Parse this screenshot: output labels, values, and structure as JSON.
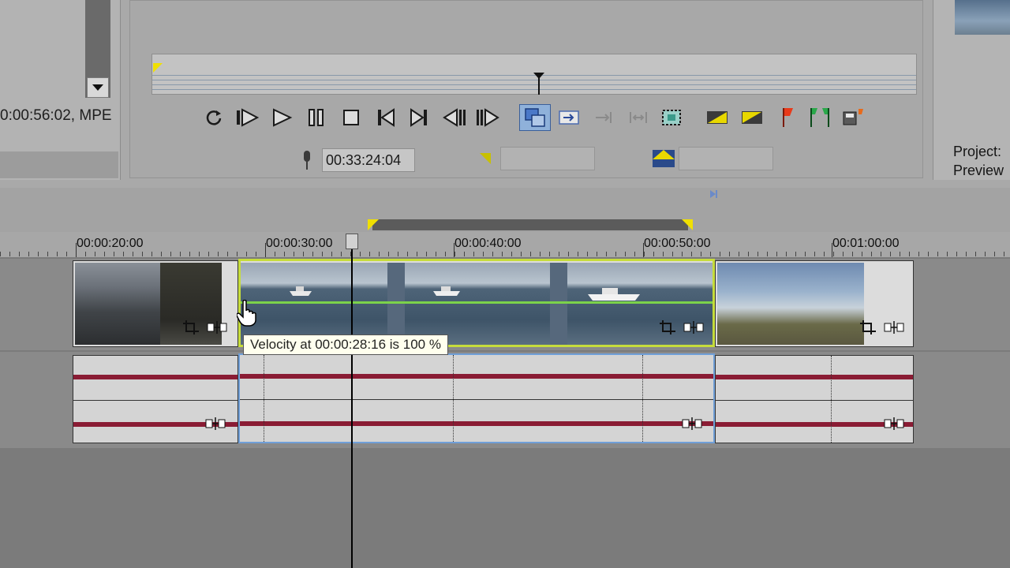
{
  "media_info": "0:00:56:02, MPE",
  "transport": {
    "buttons": [
      {
        "name": "loop-playback-button",
        "icon": "loop-icon"
      },
      {
        "name": "play-from-start-button",
        "icon": "play-from-start-icon"
      },
      {
        "name": "play-button",
        "icon": "play-icon"
      },
      {
        "name": "pause-button",
        "icon": "pause-icon"
      },
      {
        "name": "stop-button",
        "icon": "stop-icon"
      },
      {
        "name": "go-to-start-button",
        "icon": "go-to-start-icon"
      },
      {
        "name": "go-to-end-button",
        "icon": "go-to-end-icon"
      },
      {
        "name": "previous-frame-button",
        "icon": "previous-frame-icon"
      },
      {
        "name": "next-frame-button",
        "icon": "next-frame-icon"
      },
      {
        "name": "select-button",
        "icon": "select-icon",
        "active": true
      },
      {
        "name": "add-to-timeline-button",
        "icon": "add-to-timeline-icon"
      },
      {
        "name": "add-after-button",
        "icon": "add-after-icon"
      },
      {
        "name": "fit-to-fill-button",
        "icon": "fit-to-fill-icon"
      },
      {
        "name": "trim-region-button",
        "icon": "trim-region-icon"
      },
      {
        "name": "set-in-point-button",
        "icon": "in-point-icon"
      },
      {
        "name": "set-out-point-button",
        "icon": "out-point-icon"
      },
      {
        "name": "insert-marker-button",
        "icon": "marker-icon"
      },
      {
        "name": "insert-region-button",
        "icon": "region-icon"
      },
      {
        "name": "save-button",
        "icon": "save-icon"
      }
    ]
  },
  "trimmer": {
    "cursor_time": "00:33:24:04",
    "in_value": "",
    "length_value": ""
  },
  "project_label": "Project:",
  "preview_label": "Preview",
  "ruler": {
    "labels": [
      "00:00:20:00",
      "00:00:30:00",
      "00:00:40:00",
      "00:00:50:00",
      "00:01:00:00"
    ]
  },
  "tooltip": "Velocity at 00:00:28:16 is 100 %",
  "colors": {
    "selection": "#c6dc3c",
    "velocity_envelope": "#7cd24a",
    "waveform": "#8a1c34",
    "audio_selection": "#6f9fd8",
    "marker": "#f0e000"
  }
}
